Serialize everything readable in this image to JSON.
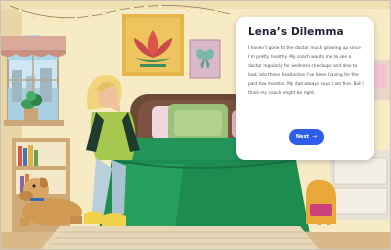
{
  "dialog": {
    "title": "Lena’s Dilemma",
    "body": "I haven’t gone to the doctor much growing up since I’m pretty healthy. My coach wants me to see a doctor regularly for wellness checkups and also to look into these headaches I’ve been having for the past few months. My dad always says I am fine. But I think my coach might be right.",
    "next_label": "Next",
    "next_icon": "arrow-right-icon"
  },
  "scene": {
    "setting": "bedroom",
    "colors": {
      "wall": "#f8edc9",
      "bedspread": "#1f8c4f",
      "floor": "#d8b987",
      "accent_button": "#2f5fea"
    }
  }
}
